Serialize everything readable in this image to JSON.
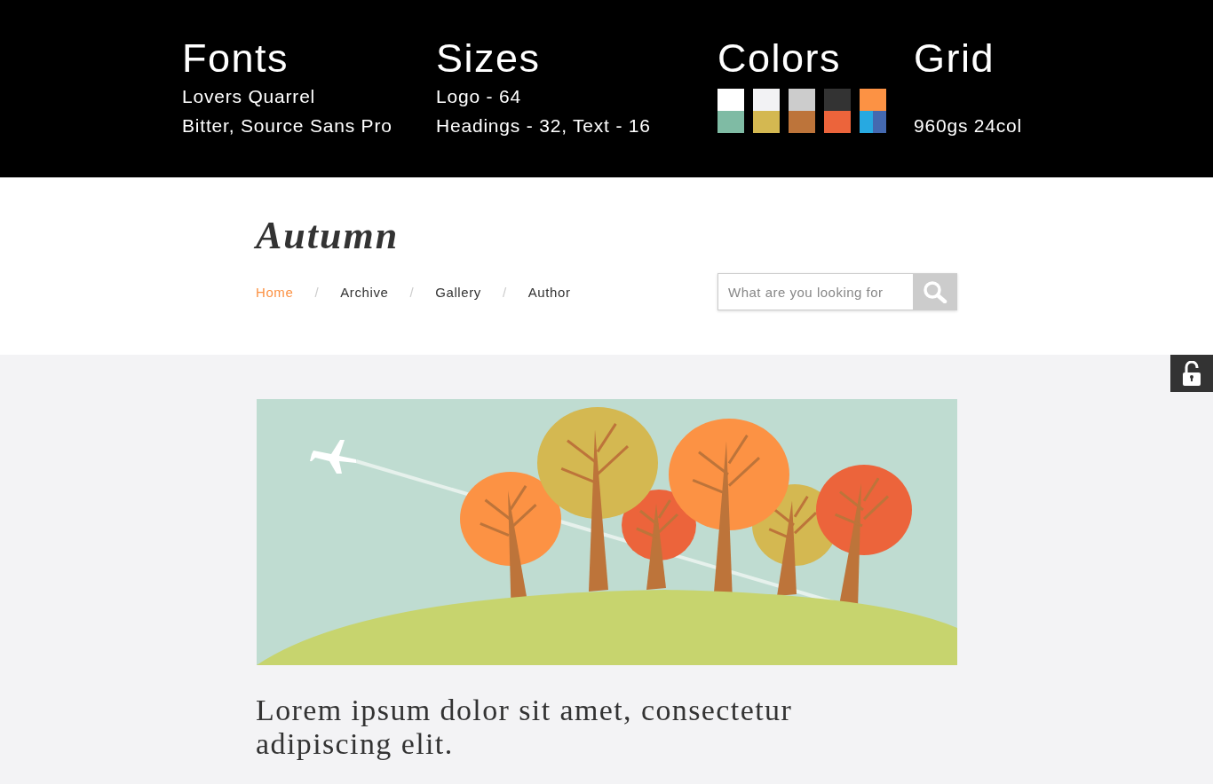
{
  "style_guide": {
    "sections": [
      {
        "kind": "text",
        "heading": "Fonts",
        "lines": [
          "Lovers Quarrel",
          "Bitter, Source Sans Pro"
        ]
      },
      {
        "kind": "text",
        "heading": "Sizes",
        "lines": [
          "Logo - 64",
          "Headings - 32, Text - 16"
        ]
      },
      {
        "kind": "palette",
        "heading": "Colors",
        "rows": [
          [
            {
              "kind": "full",
              "color": "#ffffff"
            },
            {
              "kind": "full",
              "color": "#f2f2f4"
            },
            {
              "kind": "full",
              "color": "#cccccc"
            },
            {
              "kind": "full",
              "color": "#333333"
            },
            {
              "kind": "full",
              "color": "#fc9244"
            }
          ],
          [
            {
              "kind": "full",
              "color": "#7fbba4"
            },
            {
              "kind": "full",
              "color": "#d4b851"
            },
            {
              "kind": "full",
              "color": "#bd743a"
            },
            {
              "kind": "full",
              "color": "#ec643b"
            },
            {
              "kind": "half",
              "color": "#27a9e1"
            },
            {
              "kind": "half",
              "color": "#4469b0"
            }
          ]
        ]
      },
      {
        "kind": "lower_text",
        "heading": "Grid",
        "lines": [
          "960gs 24col"
        ]
      }
    ]
  },
  "header": {
    "logo": "Autumn",
    "nav": [
      {
        "label": "Home",
        "selected": true
      },
      {
        "separator": "/",
        "label": "Archive",
        "selected": false
      },
      {
        "separator": "/",
        "label": "Gallery",
        "selected": false
      },
      {
        "separator": "/",
        "label": "Author",
        "selected": false
      }
    ],
    "search": {
      "placeholder": "What are you looking for"
    }
  },
  "content": {
    "headline": "Lorem ipsum dolor sit amet, consectetur adipiscing elit."
  }
}
